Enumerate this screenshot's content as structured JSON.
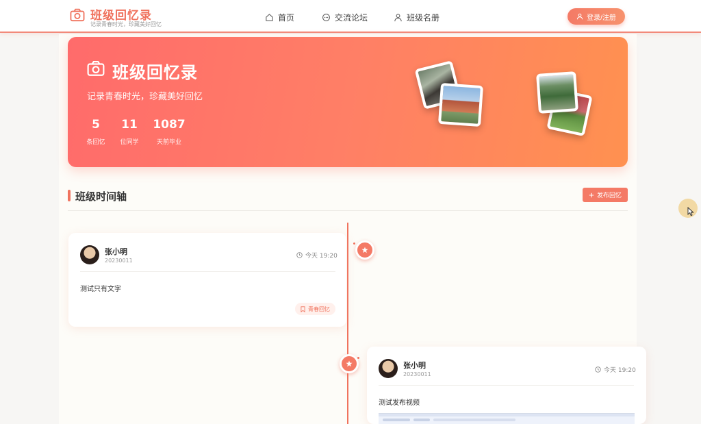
{
  "header": {
    "logo_title": "班级回忆录",
    "logo_subtitle": "记录青春时光，珍藏美好回忆",
    "nav": [
      {
        "label": "首页",
        "icon": "home-icon"
      },
      {
        "label": "交流论坛",
        "icon": "chat-icon"
      },
      {
        "label": "班级名册",
        "icon": "user-icon"
      }
    ],
    "login_label": "登录/注册"
  },
  "hero": {
    "title": "班级回忆录",
    "subtitle": "记录青春时光，珍藏美好回忆",
    "stats": [
      {
        "value": "5",
        "label": "条回忆"
      },
      {
        "value": "11",
        "label": "位同学"
      },
      {
        "value": "1087",
        "label": "天前毕业"
      }
    ]
  },
  "timeline": {
    "title": "班级时间轴",
    "publish_label": "发布回忆",
    "posts": [
      {
        "user": "张小明",
        "student_id": "20230011",
        "time": "今天 19:20",
        "text": "测试只有文字",
        "tag": "青春回忆"
      },
      {
        "user": "张小明",
        "student_id": "20230011",
        "time": "今天 19:20",
        "text": "测试发布视频"
      }
    ]
  },
  "colors": {
    "accent": "#f0735e",
    "hero_start": "#ff6b6b",
    "hero_end": "#ff9150",
    "page_bg": "#f7f6f4"
  }
}
